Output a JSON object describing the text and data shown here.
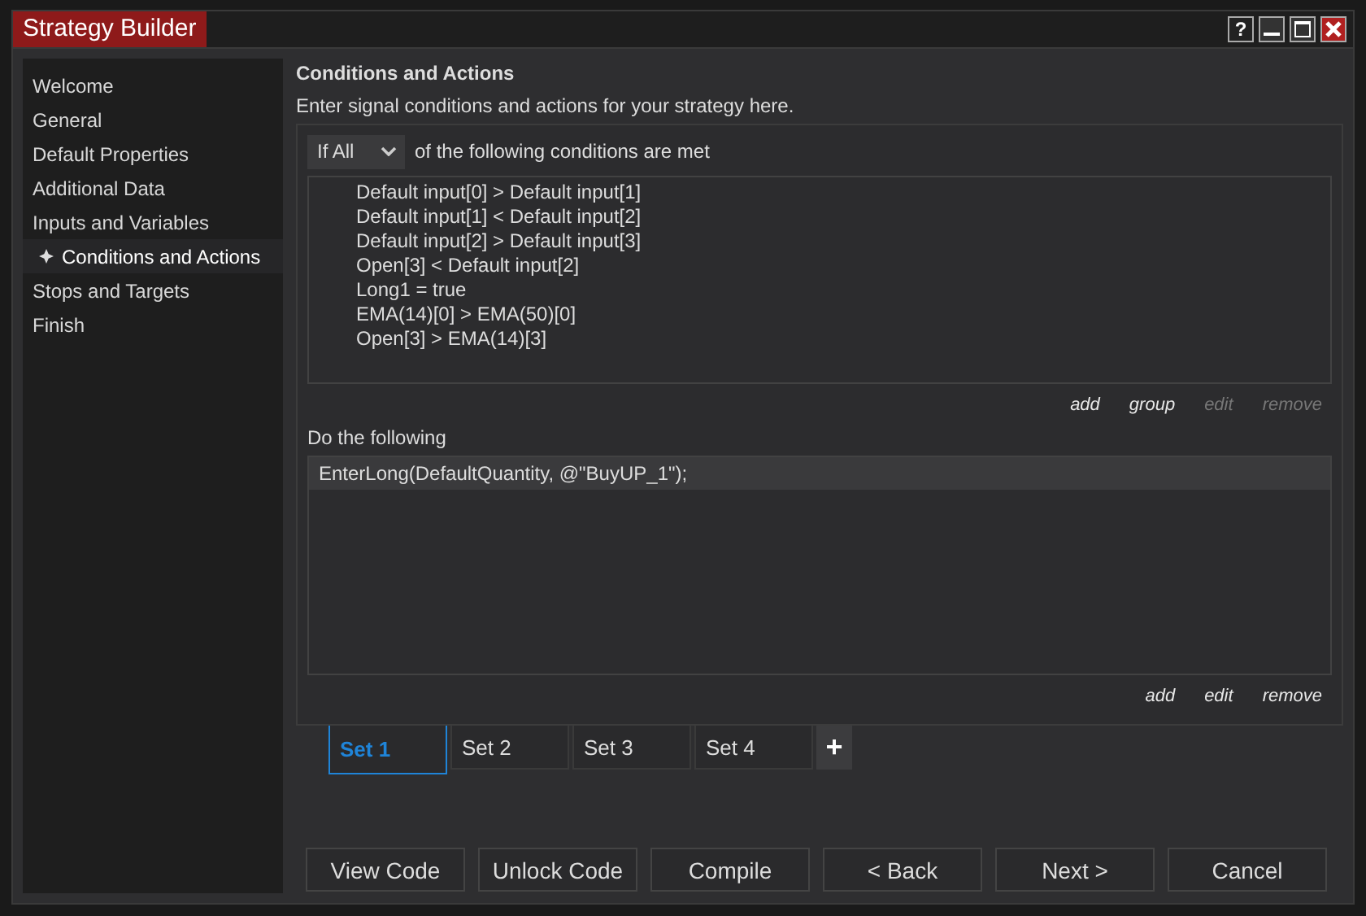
{
  "window": {
    "title": "Strategy Builder",
    "help": "?"
  },
  "sidebar": {
    "items": [
      {
        "label": "Welcome",
        "selected": false
      },
      {
        "label": "General",
        "selected": false
      },
      {
        "label": "Default Properties",
        "selected": false
      },
      {
        "label": "Additional Data",
        "selected": false
      },
      {
        "label": "Inputs and Variables",
        "selected": false
      },
      {
        "label": "Conditions and Actions",
        "selected": true
      },
      {
        "label": "Stops and Targets",
        "selected": false
      },
      {
        "label": "Finish",
        "selected": false
      }
    ]
  },
  "heading": "Conditions and Actions",
  "description": "Enter signal conditions and actions for your strategy here.",
  "conditions": {
    "mode": "If All",
    "mode_suffix": "of the following conditions are met",
    "items": [
      "Default input[0] > Default input[1]",
      "Default input[1] < Default input[2]",
      "Default input[2] > Default input[3]",
      "Open[3] < Default input[2]",
      "Long1 = true",
      "EMA(14)[0] > EMA(50)[0]",
      "Open[3] > EMA(14)[3]"
    ],
    "links": [
      {
        "label": "add",
        "disabled": false
      },
      {
        "label": "group",
        "disabled": false
      },
      {
        "label": "edit",
        "disabled": true
      },
      {
        "label": "remove",
        "disabled": true
      }
    ]
  },
  "actions": {
    "label": "Do the following",
    "items": [
      {
        "text": "EnterLong(DefaultQuantity, @\"BuyUP_1\");",
        "selected": true
      }
    ],
    "links": [
      {
        "label": "add",
        "disabled": false
      },
      {
        "label": "edit",
        "disabled": false
      },
      {
        "label": "remove",
        "disabled": false
      }
    ]
  },
  "sets": {
    "tabs": [
      {
        "label": "Set 1",
        "selected": true
      },
      {
        "label": "Set 2",
        "selected": false
      },
      {
        "label": "Set 3",
        "selected": false
      },
      {
        "label": "Set 4",
        "selected": false
      }
    ],
    "add": "+"
  },
  "buttons": [
    "View Code",
    "Unlock Code",
    "Compile",
    "< Back",
    "Next >",
    "Cancel"
  ]
}
